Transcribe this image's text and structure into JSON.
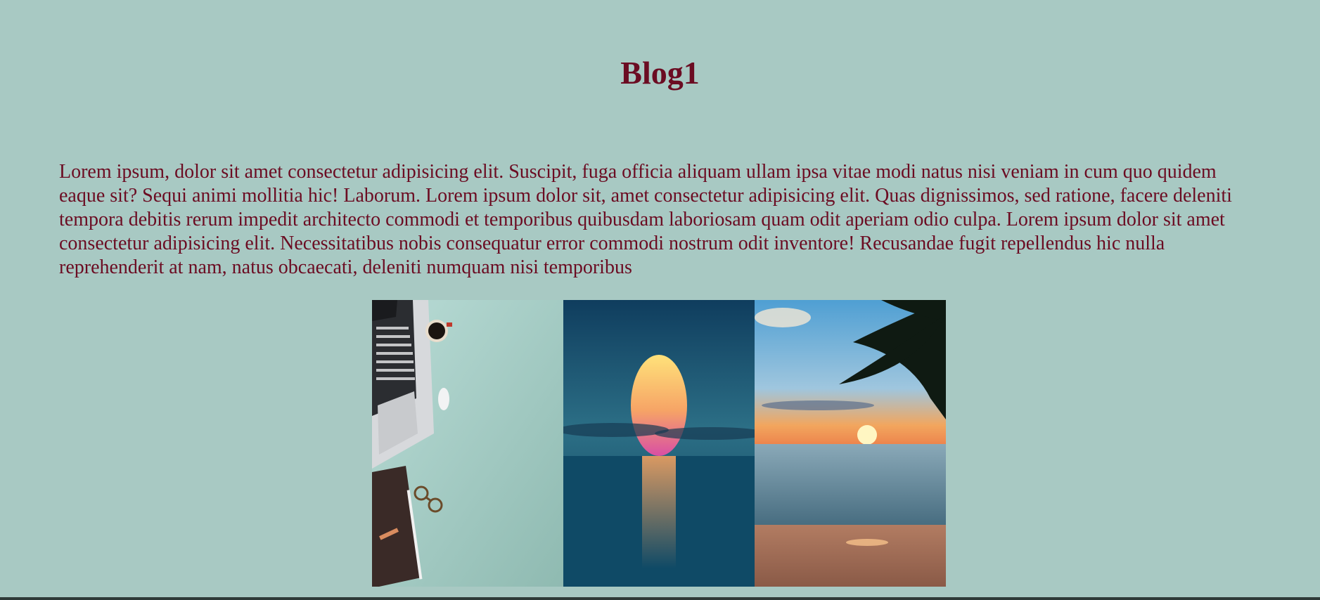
{
  "blog": {
    "title": "Blog1",
    "paragraph": "Lorem ipsum, dolor sit amet consectetur adipisicing elit. Suscipit, fuga officia aliquam ullam ipsa vitae modi natus nisi veniam in cum quo quidem eaque sit? Sequi animi mollitia hic! Laborum. Lorem ipsum dolor sit, amet consectetur adipisicing elit. Quas dignissimos, sed ratione, facere deleniti tempora debitis rerum impedit architecto commodi et temporibus quibusdam laboriosam quam odit aperiam odio culpa. Lorem ipsum dolor sit amet consectetur adipisicing elit. Necessitatibus nobis consequatur error commodi nostrum odit inventore! Recusandae fugit repellendus hic nulla reprehenderit at nam, natus obcaecati, deleniti numquam nisi temporibus"
  },
  "gallery": [
    {
      "subject": "workspace with laptop, coffee, mouse, notebook and glasses"
    },
    {
      "subject": "sun setting over ocean"
    },
    {
      "subject": "tropical beach sunset with palm leaves"
    }
  ],
  "colors": {
    "background": "#a8c9c3",
    "text": "#6b0c22"
  }
}
